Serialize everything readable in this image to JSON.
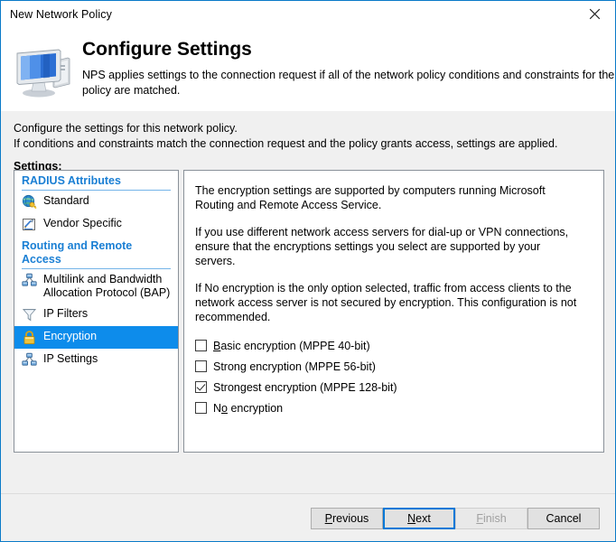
{
  "window": {
    "title": "New Network Policy",
    "close_icon": "close-icon",
    "border_color": "#0a7ac8"
  },
  "header": {
    "icon": "computer-monitor-icon",
    "title": "Configure Settings",
    "description": "NPS applies settings to the connection request if all of the network policy conditions and constraints for the policy are matched."
  },
  "instructions": {
    "line1": "Configure the settings for this network policy.",
    "line2": "If conditions and constraints match the connection request and the policy grants access, settings are applied.",
    "settings_label_accel": "S",
    "settings_label_rest": "ettings:"
  },
  "tree": {
    "groups": [
      {
        "header": "RADIUS Attributes",
        "items": [
          {
            "label": "Standard",
            "icon": "globe-key-icon",
            "selected": false
          },
          {
            "label": "Vendor Specific",
            "icon": "pencil-box-icon",
            "selected": false
          }
        ]
      },
      {
        "header": "Routing and Remote Access",
        "items": [
          {
            "label": "Multilink and Bandwidth Allocation Protocol (BAP)",
            "icon": "network-nodes-icon",
            "selected": false
          },
          {
            "label": "IP Filters",
            "icon": "funnel-icon",
            "selected": false
          },
          {
            "label": "Encryption",
            "icon": "padlock-icon",
            "selected": true
          },
          {
            "label": "IP Settings",
            "icon": "network-nodes-icon",
            "selected": false
          }
        ]
      }
    ],
    "selection_color": "#0d8ceb",
    "group_header_color": "#1a7fd4"
  },
  "content": {
    "paragraphs": [
      "The encryption settings are supported by computers running Microsoft Routing and Remote Access Service.",
      "If you use different network access servers for dial-up or VPN connections, ensure that the encryptions settings you select are supported by your servers.",
      "If No encryption is the only option selected, traffic from access clients to the network access server is not secured by encryption. This configuration is not recommended."
    ],
    "checkboxes": [
      {
        "accel": "B",
        "before": "",
        "after": "asic encryption (MPPE 40-bit)",
        "checked": false
      },
      {
        "accel": "g",
        "before": "Stron",
        "after": " encryption (MPPE 56-bit)",
        "checked": false
      },
      {
        "accel": "g",
        "before": "Stron",
        "after": "est encryption (MPPE 128-bit)",
        "checked": true
      },
      {
        "accel": "o",
        "before": "N",
        "after": " encryption",
        "checked": false
      }
    ]
  },
  "buttons": {
    "previous": {
      "accel": "P",
      "rest": "revious",
      "state": "normal"
    },
    "next": {
      "accel": "N",
      "rest": "ext",
      "state": "focused"
    },
    "finish": {
      "accel": "F",
      "rest": "inish",
      "state": "disabled"
    },
    "cancel": {
      "accel": "",
      "rest": "Cancel",
      "state": "normal"
    }
  }
}
